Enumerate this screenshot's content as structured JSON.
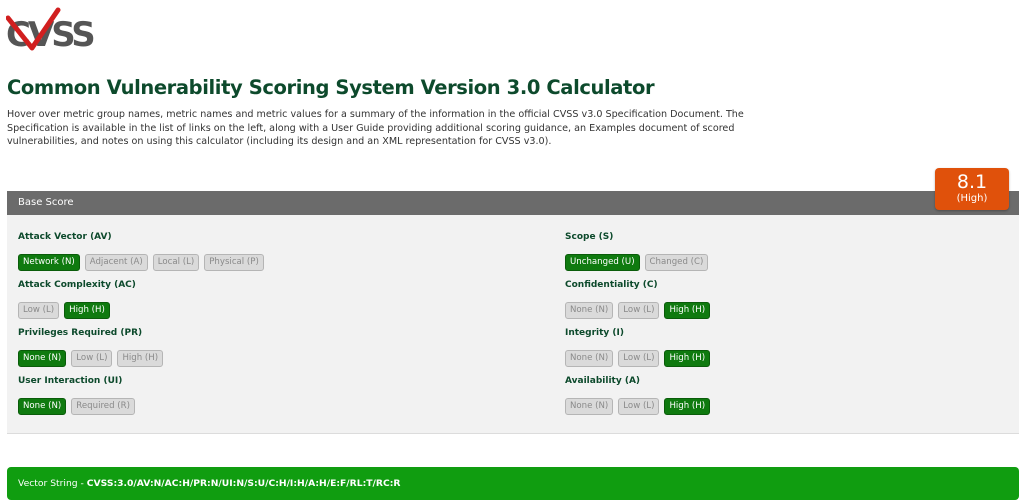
{
  "logo": {
    "text": "CVSS",
    "icon": "cvss-logo"
  },
  "title": "Common Vulnerability Scoring System Version 3.0 Calculator",
  "intro": "Hover over metric group names, metric names and metric values for a summary of the information in the official CVSS v3.0 Specification Document. The Specification is available in the list of links on the left, along with a User Guide providing additional scoring guidance, an Examples document of scored vulnerabilities, and notes on using this calculator (including its design and an XML representation for CVSS v3.0).",
  "score": {
    "value": "8.1",
    "severity": "(High)",
    "color": "#e0510b"
  },
  "base": {
    "header": "Base Score",
    "metrics": [
      {
        "label": "Attack Vector (AV)",
        "options": [
          {
            "label": "Network (N)",
            "selected": true
          },
          {
            "label": "Adjacent (A)",
            "selected": false
          },
          {
            "label": "Local (L)",
            "selected": false
          },
          {
            "label": "Physical (P)",
            "selected": false
          }
        ]
      },
      {
        "label": "Attack Complexity (AC)",
        "options": [
          {
            "label": "Low (L)",
            "selected": false
          },
          {
            "label": "High (H)",
            "selected": true
          }
        ]
      },
      {
        "label": "Privileges Required (PR)",
        "options": [
          {
            "label": "None (N)",
            "selected": true
          },
          {
            "label": "Low (L)",
            "selected": false
          },
          {
            "label": "High (H)",
            "selected": false
          }
        ]
      },
      {
        "label": "User Interaction (UI)",
        "options": [
          {
            "label": "None (N)",
            "selected": true
          },
          {
            "label": "Required (R)",
            "selected": false
          }
        ]
      },
      {
        "label": "Scope (S)",
        "options": [
          {
            "label": "Unchanged (U)",
            "selected": true
          },
          {
            "label": "Changed (C)",
            "selected": false
          }
        ]
      },
      {
        "label": "Confidentiality (C)",
        "options": [
          {
            "label": "None (N)",
            "selected": false
          },
          {
            "label": "Low (L)",
            "selected": false
          },
          {
            "label": "High (H)",
            "selected": true
          }
        ]
      },
      {
        "label": "Integrity (I)",
        "options": [
          {
            "label": "None (N)",
            "selected": false
          },
          {
            "label": "Low (L)",
            "selected": false
          },
          {
            "label": "High (H)",
            "selected": true
          }
        ]
      },
      {
        "label": "Availability (A)",
        "options": [
          {
            "label": "None (N)",
            "selected": false
          },
          {
            "label": "Low (L)",
            "selected": false
          },
          {
            "label": "High (H)",
            "selected": true
          }
        ]
      }
    ]
  },
  "vector": {
    "prefix": "Vector String - ",
    "value": "CVSS:3.0/AV:N/AC:H/PR:N/UI:N/S:U/C:H/I:H/A:H/E:F/RL:T/RC:R"
  },
  "colors": {
    "selected": "#0f7a0f",
    "vector_bar": "#109d10",
    "title": "#0d4a2c"
  }
}
